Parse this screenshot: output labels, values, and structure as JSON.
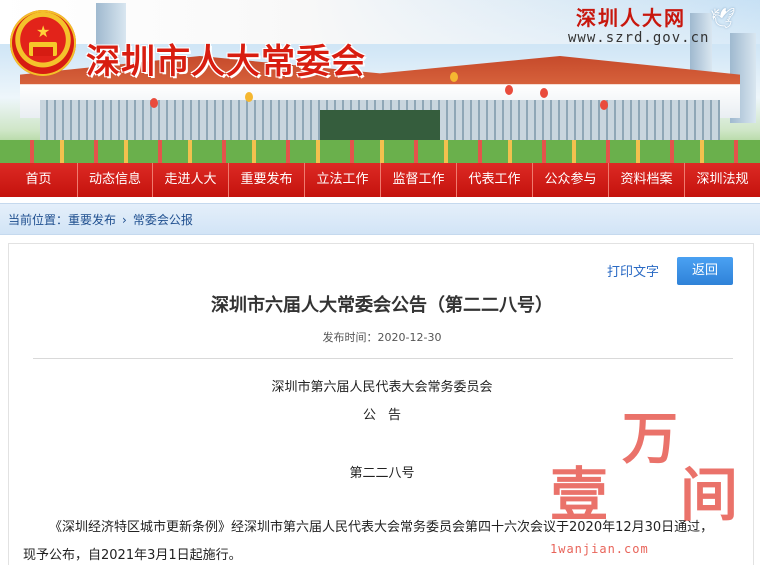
{
  "header": {
    "site_title": "深圳市人大常委会",
    "brand_name": "深圳人大网",
    "brand_url": "www.szrd.gov.cn"
  },
  "nav": {
    "items": [
      "首页",
      "动态信息",
      "走进人大",
      "重要发布",
      "立法工作",
      "监督工作",
      "代表工作",
      "公众参与",
      "资料档案",
      "深圳法规"
    ]
  },
  "breadcrumb": {
    "prefix": "当前位置：",
    "level1": "重要发布",
    "separator": "›",
    "level2": "常委会公报"
  },
  "article": {
    "print_label": "打印文字",
    "back_label": "返回",
    "title": "深圳市六届人大常委会公告（第二二八号）",
    "publish_time": "发布时间：2020-12-30",
    "issuer": "深圳市第六届人民代表大会常务委员会",
    "notice_word": "公告",
    "doc_number": "第二二八号",
    "body": "《深圳经济特区城市更新条例》经深圳市第六届人民代表大会常务委员会第四十六次会议于2020年12月30日通过，现予公布，自2021年3月1日起施行。"
  },
  "watermark": {
    "chars": [
      "壹",
      "万",
      "间"
    ],
    "url": "1wanjian.com"
  },
  "colors": {
    "nav_red": "#c4120d",
    "title_red": "#d81d10",
    "link_blue": "#2a6ac4",
    "button_blue": "#3a8fe4"
  }
}
